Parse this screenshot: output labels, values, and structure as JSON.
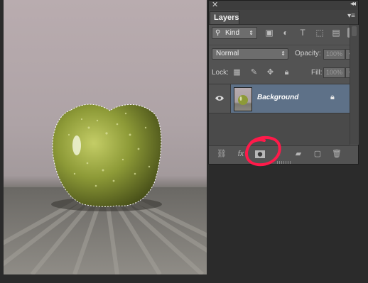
{
  "panel": {
    "tab_label": "Layers",
    "filter": {
      "kind_label": "Kind"
    },
    "blend": {
      "mode": "Normal",
      "opacity_label": "Opacity:",
      "opacity_value": "100%"
    },
    "lock": {
      "label": "Lock:",
      "fill_label": "Fill:",
      "fill_value": "100%"
    },
    "layers": [
      {
        "name": "Background",
        "visible": true,
        "locked": true,
        "selected": true
      }
    ]
  },
  "colors": {
    "selected_row": "#5e7188",
    "panel_bg": "#535353",
    "annotation_red": "#ff1a4a"
  }
}
